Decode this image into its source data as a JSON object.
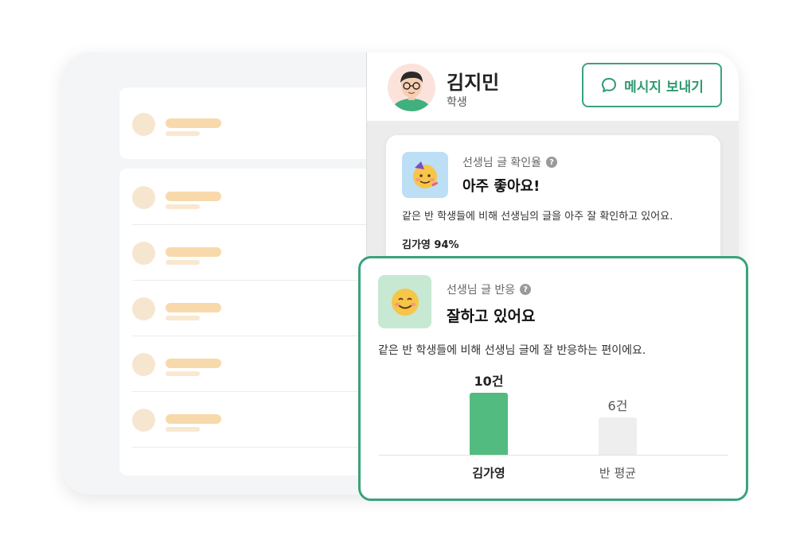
{
  "profile": {
    "name": "김지민",
    "role": "학생",
    "message_button_label": "메시지 보내기"
  },
  "card_read_rate": {
    "label": "선생님 글 확인율",
    "headline": "아주 좋아요!",
    "description": "같은 반 학생들에 비해 선생님의 글을 아주 잘 확인하고 있어요.",
    "score": "김가영 94%"
  },
  "card_reaction": {
    "label": "선생님 글 반응",
    "headline": "잘하고 있어요",
    "description": "같은 반 학생들에 비해 선생님 글에 잘 반응하는 편이에요."
  },
  "chart_data": {
    "type": "bar",
    "categories": [
      "김가영",
      "반 평균"
    ],
    "values": [
      10,
      6
    ],
    "value_labels": [
      "10건",
      "6건"
    ],
    "colors": [
      "#52bb80",
      "#eeeeee"
    ]
  },
  "colors": {
    "accent": "#3aa37a",
    "student_bar": "#52bb80",
    "average_bar": "#eeeeee"
  }
}
